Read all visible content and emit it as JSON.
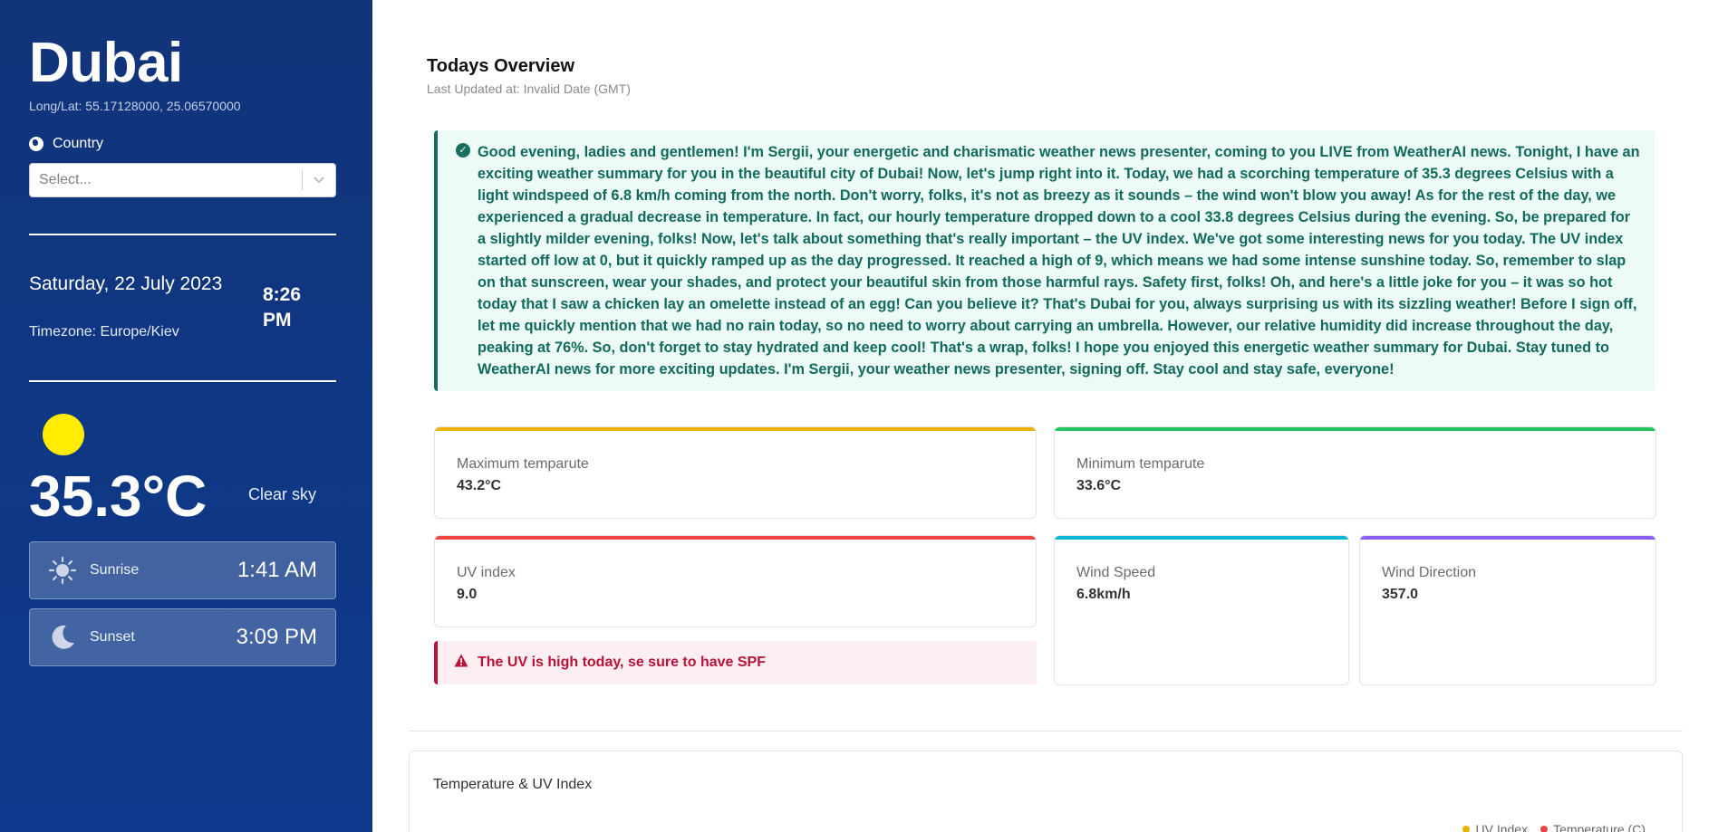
{
  "sidebar": {
    "city": "Dubai",
    "longlat": "Long/Lat: 55.17128000, 25.06570000",
    "country_label": "Country",
    "country_placeholder": "Select...",
    "date": "Saturday, 22 July 2023",
    "time": "8:26 PM",
    "timezone": "Timezone: Europe/Kiev",
    "temperature": "35.3°C",
    "sky": "Clear sky",
    "sunrise": {
      "label": "Sunrise",
      "value": "1:41 AM"
    },
    "sunset": {
      "label": "Sunset",
      "value": "3:09 PM"
    }
  },
  "overview": {
    "title": "Todays Overview",
    "updated": "Last Updated at: Invalid Date (GMT)",
    "summary": "Good evening, ladies and gentlemen! I'm Sergii, your energetic and charismatic weather news presenter, coming to you LIVE from WeatherAI news. Tonight, I have an exciting weather summary for you in the beautiful city of Dubai! Now, let's jump right into it. Today, we had a scorching temperature of 35.3 degrees Celsius with a light windspeed of 6.8 km/h coming from the north. Don't worry, folks, it's not as breezy as it sounds – the wind won't blow you away! As for the rest of the day, we experienced a gradual decrease in temperature. In fact, our hourly temperature dropped down to a cool 33.8 degrees Celsius during the evening. So, be prepared for a slightly milder evening, folks! Now, let's talk about something that's really important – the UV index. We've got some interesting news for you today. The UV index started off low at 0, but it quickly ramped up as the day progressed. It reached a high of 9, which means we had some intense sunshine today. So, remember to slap on that sunscreen, wear your shades, and protect your beautiful skin from those harmful rays. Safety first, folks! Oh, and here's a little joke for you – it was so hot today that I saw a chicken lay an omelette instead of an egg! Can you believe it? That's Dubai for you, always surprising us with its sizzling weather! Before I sign off, let me quickly mention that we had no rain today, so no need to worry about carrying an umbrella. However, our relative humidity did increase throughout the day, peaking at 76%. So, don't forget to stay hydrated and keep cool! That's a wrap, folks! I hope you enjoyed this energetic weather summary for Dubai. Stay tuned to WeatherAI news for more exciting updates. I'm Sergii, your weather news presenter, signing off. Stay cool and stay safe, everyone!"
  },
  "cards": {
    "max": {
      "label": "Maximum temparute",
      "value": "43.2°C",
      "color": "#eab308"
    },
    "min": {
      "label": "Minimum temparute",
      "value": "33.6°C",
      "color": "#22c55e"
    },
    "uv": {
      "label": "UV index",
      "value": "9.0",
      "color": "#ef4444"
    },
    "wind_speed": {
      "label": "Wind Speed",
      "value": "6.8km/h",
      "color": "#06b6d4"
    },
    "wind_direction": {
      "label": "Wind Direction",
      "value": "357.0",
      "color": "#8b5cf6"
    }
  },
  "uv_alert": "The UV is high today, se sure to have SPF",
  "chart": {
    "title": "Temperature & UV Index",
    "legend": [
      {
        "name": "UV Index",
        "color": "#eab308"
      },
      {
        "name": "Temperature (C)",
        "color": "#ef4444"
      }
    ]
  },
  "icons": {
    "country": "globe-icon",
    "select": "chevron-down-icon",
    "sunrise": "sun-icon",
    "sunset": "moon-icon",
    "summary": "check-circle-icon",
    "alert": "warning-icon"
  }
}
